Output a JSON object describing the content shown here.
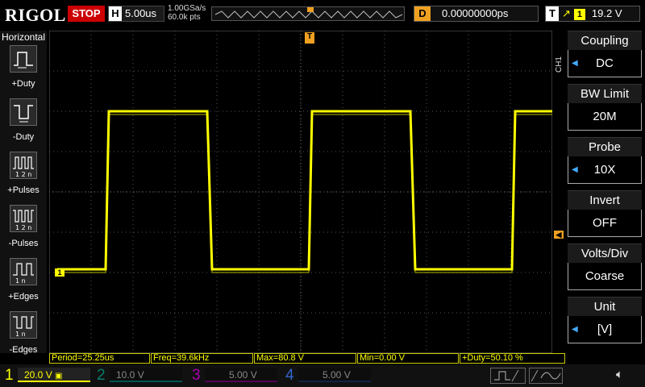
{
  "brand": "RIGOL",
  "run_state": "STOP",
  "horizontal": {
    "label": "H",
    "timebase": "5.00us"
  },
  "sample": {
    "rate": "1.00GSa/s",
    "points": "60.0k pts"
  },
  "delay": {
    "label": "D",
    "value": "0.00000000ps"
  },
  "trigger": {
    "label": "T",
    "edge_icon": "rising-edge-icon",
    "channel": "1",
    "level": "19.2 V",
    "marker": "T"
  },
  "left_panel": {
    "title": "Horizontal",
    "items": [
      {
        "label": "+Duty",
        "icon": "pos-duty-icon"
      },
      {
        "label": "-Duty",
        "icon": "neg-duty-icon"
      },
      {
        "label": "+Pulses",
        "icon": "pos-pulses-icon"
      },
      {
        "label": "-Pulses",
        "icon": "neg-pulses-icon"
      },
      {
        "label": "+Edges",
        "icon": "pos-edges-icon"
      },
      {
        "label": "-Edges",
        "icon": "neg-edges-icon"
      }
    ]
  },
  "right_panel": {
    "channel_label": "CH1",
    "items": [
      {
        "title": "Coupling",
        "value": "DC"
      },
      {
        "title": "BW Limit",
        "value": "20M"
      },
      {
        "title": "Probe",
        "value": "10X"
      },
      {
        "title": "Invert",
        "value": "OFF"
      },
      {
        "title": "Volts/Div",
        "value": "Coarse"
      },
      {
        "title": "Unit",
        "value": "[V]"
      }
    ]
  },
  "measurements": {
    "period": "Period=25.25us",
    "freq": "Freq=39.6kHz",
    "max": "Max=80.8 V",
    "min": "Min=0.00 V",
    "duty": "+Duty=50.10 %"
  },
  "channels": [
    {
      "num": "1",
      "scale": "20.0 V",
      "color": "#ffff00"
    },
    {
      "num": "2",
      "scale": "10.0 V",
      "color": "#00ccaa"
    },
    {
      "num": "3",
      "scale": "5.00 V",
      "color": "#ff00ff"
    },
    {
      "num": "4",
      "scale": "5.00 V",
      "color": "#3399ff"
    }
  ],
  "waveform": {
    "color": "#ffff00",
    "ch_marker": "1",
    "level_marker_color": "#f0a020"
  },
  "colors": {
    "trace": "#ffff00",
    "stop": "#cc0000",
    "accent": "#f0a020"
  }
}
